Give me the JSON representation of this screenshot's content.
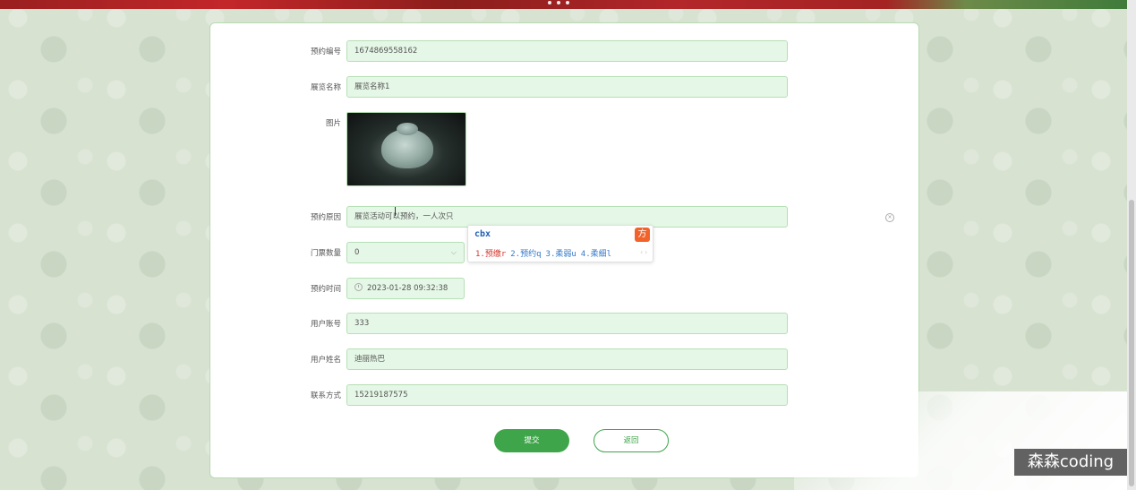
{
  "form": {
    "fields": [
      {
        "label": "预约编号",
        "value": "1674869558162"
      },
      {
        "label": "展览名称",
        "value": "展览名称1"
      },
      {
        "label": "图片",
        "value": ""
      },
      {
        "label": "预约原因",
        "value": "展览活动可以预约，一人次只"
      },
      {
        "label": "门票数量",
        "value": "0"
      },
      {
        "label": "预约时间",
        "value": "2023-01-28 09:32:38"
      },
      {
        "label": "用户账号",
        "value": "333"
      },
      {
        "label": "用户姓名",
        "value": "迪丽热巴"
      },
      {
        "label": "联系方式",
        "value": "15219187575"
      }
    ],
    "submit_label": "提交",
    "back_label": "返回"
  },
  "ime": {
    "input": "cbx",
    "logo": "方",
    "candidates": [
      "1.预缴r",
      "2.预约q",
      "3.柔弱u",
      "4.柔细l"
    ]
  },
  "watermark": "森森coding",
  "icons": {
    "select_arrow": "chevron-down-icon",
    "time": "clock-icon",
    "clear": "clear-icon"
  },
  "colors": {
    "accent": "#3fa54b",
    "field_bg": "#e5f7e6",
    "field_border": "#b6dfb5"
  }
}
